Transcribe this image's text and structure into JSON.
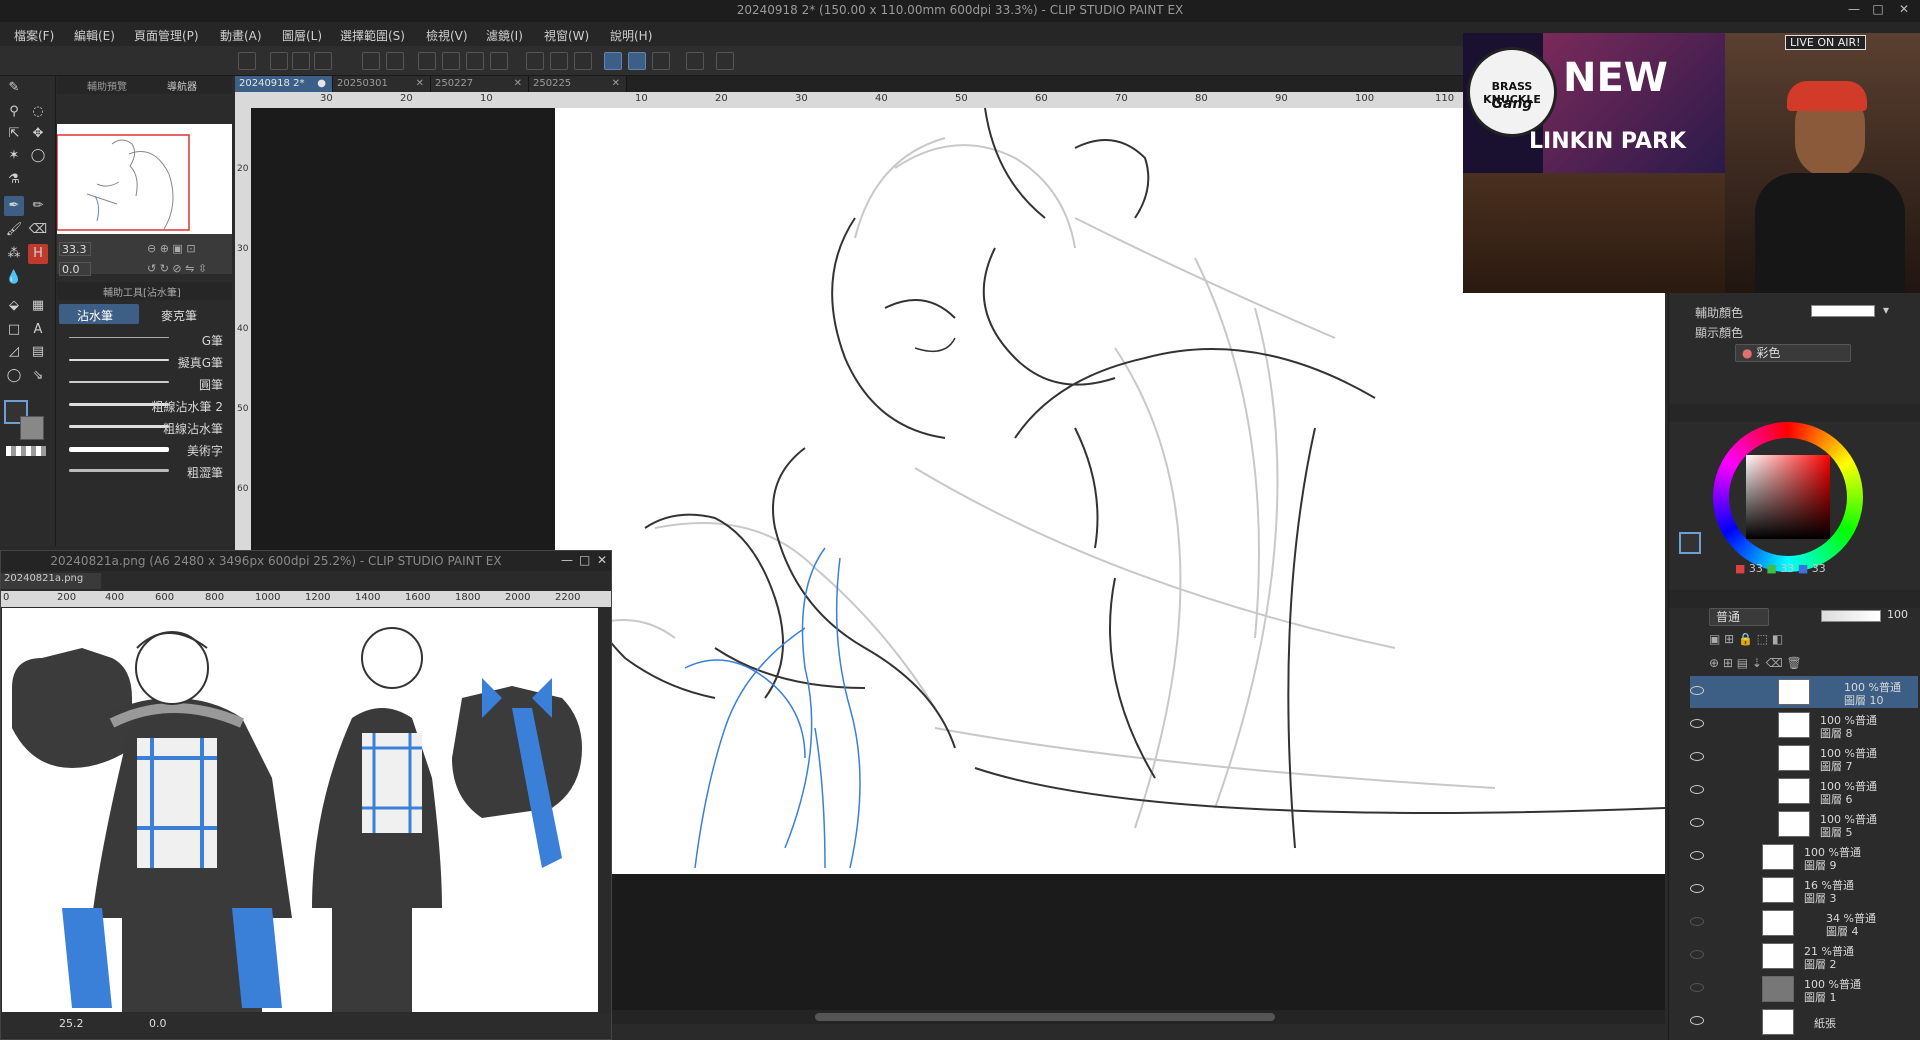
{
  "window": {
    "title": "20240918 2* (150.00 x 110.00mm 600dpi 33.3%) - CLIP STUDIO PAINT EX",
    "min": "—",
    "max": "□",
    "close": "✕"
  },
  "menu": [
    "檔案(F)",
    "編輯(E)",
    "頁面管理(P)",
    "動畫(A)",
    "圖層(L)",
    "選擇範圍(S)",
    "檢視(V)",
    "濾鏡(I)",
    "視窗(W)",
    "說明(H)"
  ],
  "navigator": {
    "tab1": "輔助預覽",
    "tab2": "導航器",
    "zoom": "33.3",
    "angle": "0.0"
  },
  "subtool": {
    "header": "輔助工具[沾水筆]",
    "tab_active": "沾水筆",
    "tab_other": "麥克筆",
    "brushes": [
      "G筆",
      "擬真G筆",
      "圓筆",
      "粗線沾水筆 2",
      "粗線沾水筆",
      "美術字",
      "粗澀筆"
    ]
  },
  "doc_tabs": [
    {
      "label": "20240918 2*",
      "active": true,
      "dot": "●"
    },
    {
      "label": "20250301",
      "active": false,
      "dot": "✕"
    },
    {
      "label": "250227",
      "active": false,
      "dot": "✕"
    },
    {
      "label": "250225",
      "active": false,
      "dot": "✕"
    }
  ],
  "ruler_top": [
    "30",
    "20",
    "10",
    "10",
    "20",
    "30",
    "40",
    "50",
    "60",
    "70",
    "80",
    "90",
    "100",
    "110"
  ],
  "ruler_left": [
    "20",
    "30",
    "40",
    "50",
    "60"
  ],
  "subwindow": {
    "title": "20240821a.png (A6 2480 x 3496px 600dpi 25.2%) - CLIP STUDIO PAINT EX",
    "tab": "20240821a.png",
    "ruler": [
      "0",
      "200",
      "400",
      "600",
      "800",
      "1000",
      "1200",
      "1400",
      "1600",
      "1800",
      "2000",
      "2200"
    ],
    "zoom": "25.2",
    "angle": "0.0"
  },
  "color_panel": {
    "sub_color_label": "輔助顏色",
    "display_color_label": "顯示顏色",
    "mode": "彩色",
    "r": "33",
    "g": "33",
    "b": "33"
  },
  "layer_panel": {
    "blend": "普通",
    "opacity": "100",
    "layers": [
      {
        "pct": "100 %普通",
        "name": "圖層 10",
        "selected": true,
        "indent": true
      },
      {
        "pct": "100 %普通",
        "name": "圖層 8",
        "selected": false,
        "indent": true
      },
      {
        "pct": "100 %普通",
        "name": "圖層 7",
        "selected": false,
        "indent": true
      },
      {
        "pct": "100 %普通",
        "name": "圖層 6",
        "selected": false,
        "indent": true
      },
      {
        "pct": "100 %普通",
        "name": "圖層 5",
        "selected": false,
        "indent": true
      },
      {
        "pct": "100 %普通",
        "name": "圖層 9",
        "selected": false,
        "indent": false
      },
      {
        "pct": "16 %普通",
        "name": "圖層 3",
        "selected": false,
        "indent": false
      },
      {
        "pct": "34 %普通",
        "name": "圖層 4",
        "selected": false,
        "indent": false
      },
      {
        "pct": "21 %普通",
        "name": "圖層 2",
        "selected": false,
        "indent": false
      },
      {
        "pct": "100 %普通",
        "name": "圖層 1",
        "selected": false,
        "indent": false
      },
      {
        "pct": "",
        "name": "紙張",
        "selected": false,
        "indent": false
      }
    ]
  },
  "overlay": {
    "badge": "LIVE ON AIR!",
    "logo_line1": "BRASS KNUCKLE",
    "logo_line2": "Gang",
    "headline1": "NEW",
    "headline2": "LINKIN PARK"
  },
  "colors": {
    "accent": "#3d5f86",
    "canvas": "#ffffff",
    "line_blue": "#3a7fd8"
  }
}
